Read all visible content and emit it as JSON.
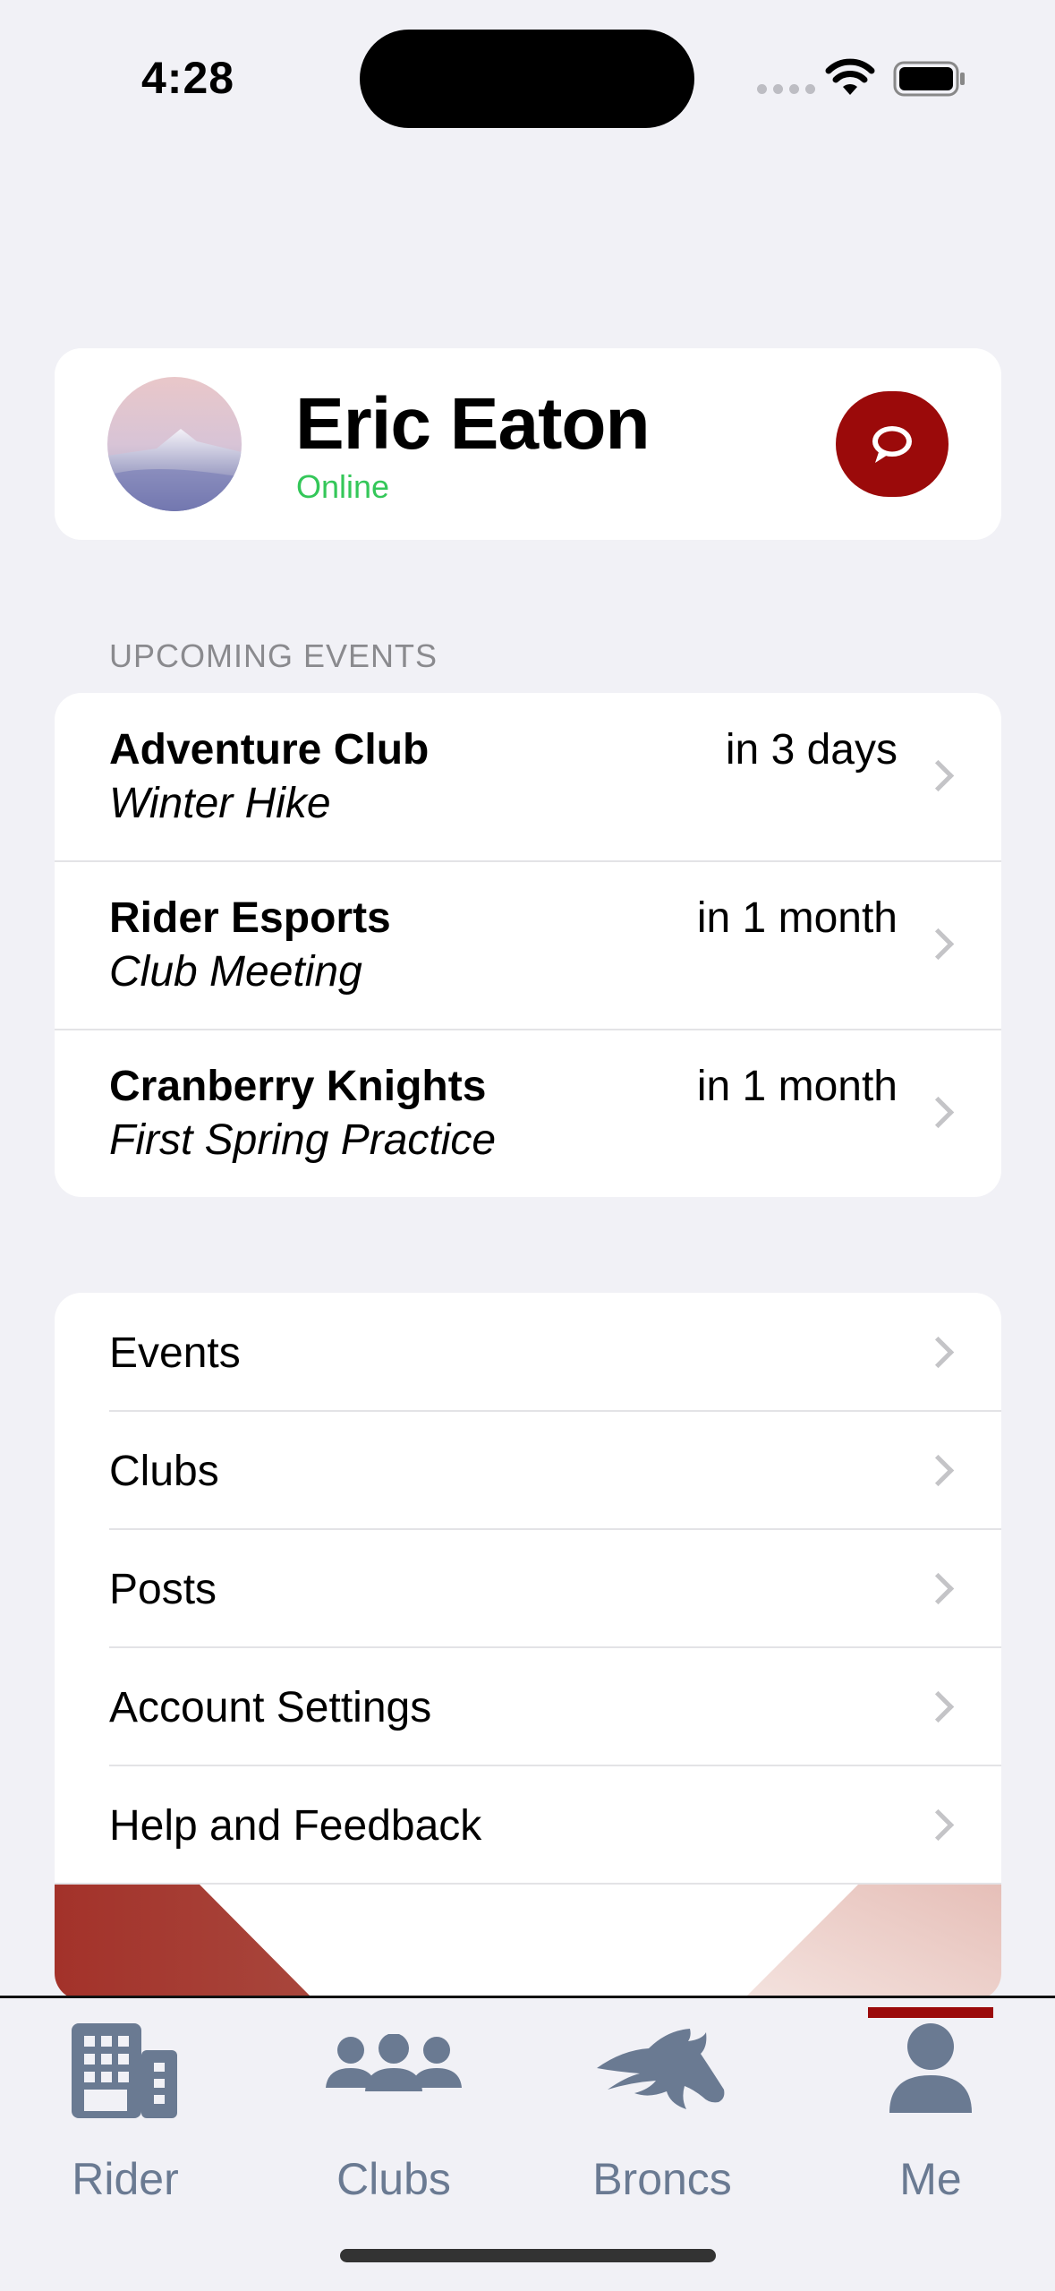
{
  "status_bar": {
    "time": "4:28"
  },
  "profile": {
    "name": "Eric Eaton",
    "status": "Online",
    "status_color": "#34c759",
    "action_icon": "chat-bubble-icon"
  },
  "upcoming": {
    "header": "UPCOMING EVENTS",
    "items": [
      {
        "club": "Adventure Club",
        "event": "Winter Hike",
        "when": "in 3 days"
      },
      {
        "club": "Rider Esports",
        "event": "Club Meeting",
        "when": "in 1 month"
      },
      {
        "club": "Cranberry Knights",
        "event": "First Spring Practice",
        "when": "in 1 month"
      }
    ]
  },
  "menu": {
    "items": [
      {
        "label": "Events"
      },
      {
        "label": "Clubs"
      },
      {
        "label": "Posts"
      },
      {
        "label": "Account Settings"
      },
      {
        "label": "Help and Feedback"
      }
    ]
  },
  "tabs": {
    "items": [
      {
        "label": "Rider",
        "icon": "building-icon"
      },
      {
        "label": "Clubs",
        "icon": "people-group-icon"
      },
      {
        "label": "Broncs",
        "icon": "horse-head-icon"
      },
      {
        "label": "Me",
        "icon": "person-icon"
      }
    ],
    "selected": "Me",
    "accent_color": "#9b0a0a",
    "icon_color": "#6a7a92"
  }
}
